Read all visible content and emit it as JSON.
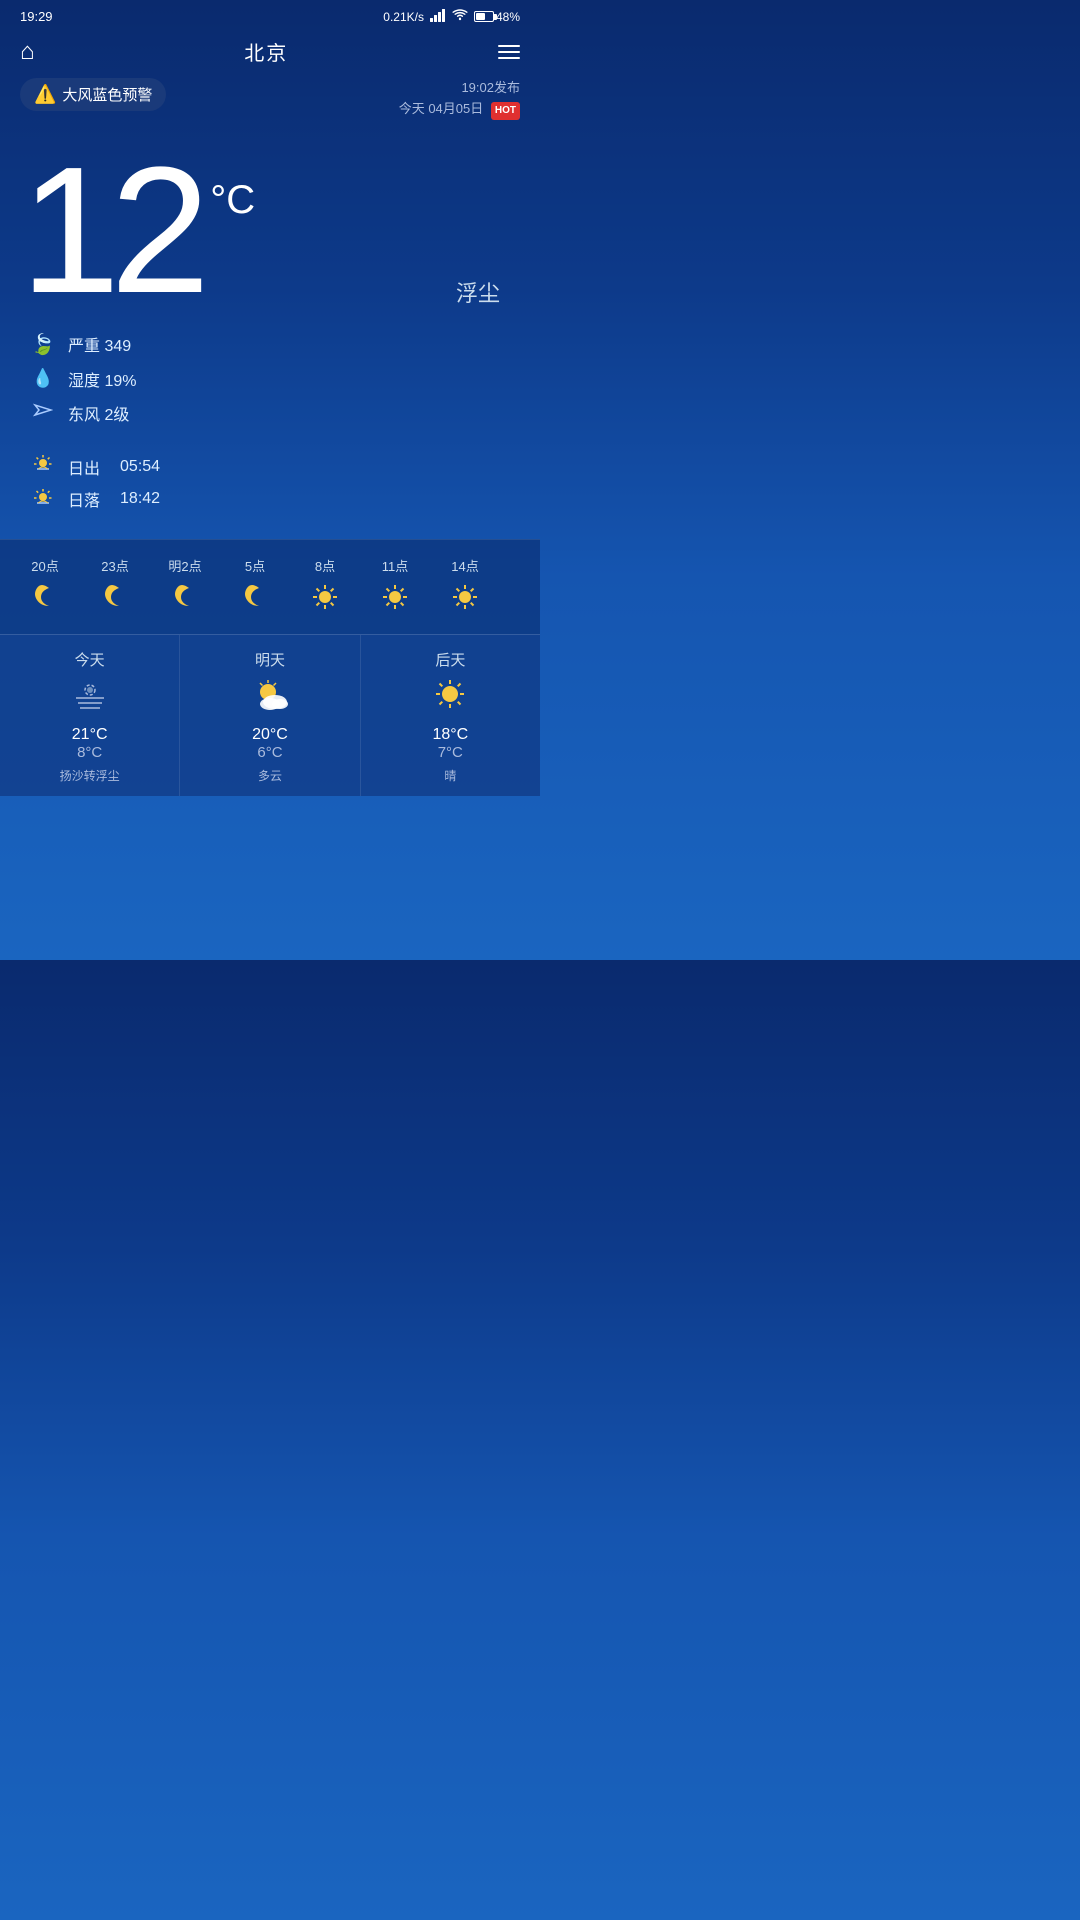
{
  "statusBar": {
    "time": "19:29",
    "speed": "0.21K/s",
    "battery": "48%"
  },
  "header": {
    "city": "北京",
    "homeIcon": "⌂",
    "menuLabel": "menu"
  },
  "warning": {
    "text": "大风蓝色预警",
    "publishTime": "19:02发布",
    "dateText": "今天 04月05日",
    "hotBadge": "HOT"
  },
  "current": {
    "temperature": "12",
    "unit": "°C",
    "description": "浮尘"
  },
  "stats": [
    {
      "icon": "leaf",
      "label": "严重 349"
    },
    {
      "icon": "drop",
      "label": "湿度 19%"
    },
    {
      "icon": "wind",
      "label": "东风 2级"
    }
  ],
  "sun": [
    {
      "icon": "sunrise",
      "label": "日出",
      "time": "05:54"
    },
    {
      "icon": "sunset",
      "label": "日落",
      "time": "18:42"
    }
  ],
  "hourly": [
    {
      "time": "20点",
      "icon": "moon",
      "type": "moon"
    },
    {
      "time": "23点",
      "icon": "moon",
      "type": "moon"
    },
    {
      "time": "明2点",
      "icon": "moon",
      "type": "moon"
    },
    {
      "time": "5点",
      "icon": "moon",
      "type": "moon"
    },
    {
      "time": "8点",
      "icon": "sun",
      "type": "sun"
    },
    {
      "time": "11点",
      "icon": "sun",
      "type": "sun"
    },
    {
      "time": "14点",
      "icon": "sun",
      "type": "sun"
    }
  ],
  "daily": [
    {
      "label": "今天",
      "iconType": "hazy",
      "high": "21°C",
      "low": "8°C",
      "desc": "扬沙转浮尘"
    },
    {
      "label": "明天",
      "iconType": "partlyCloudy",
      "high": "20°C",
      "low": "6°C",
      "desc": "多云"
    },
    {
      "label": "后天",
      "iconType": "sunny",
      "high": "18°C",
      "low": "7°C",
      "desc": "晴"
    }
  ]
}
